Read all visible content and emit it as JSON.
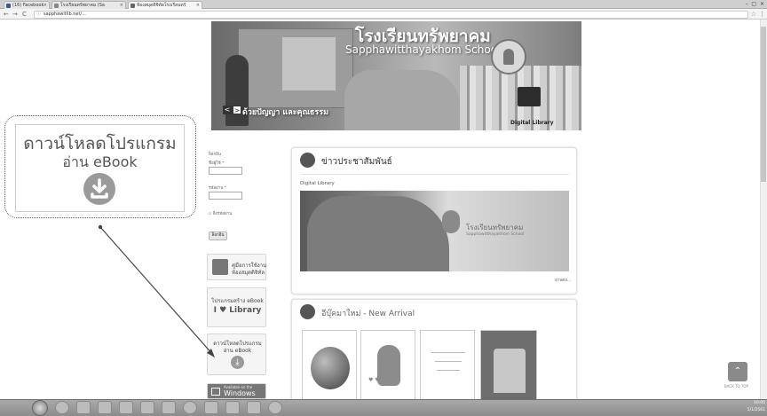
{
  "browser": {
    "tabs": [
      {
        "label": "(16) Facebook"
      },
      {
        "label": "โรงเรียนทรัพยาคม (Sa"
      },
      {
        "label": "ห้องสมุดดิจิทัลโรงเรียนทรั"
      }
    ],
    "window_controls": "– ▢ ×",
    "url": "sapphawitlib.net/..."
  },
  "banner": {
    "school_name_th": "โรงเรียนทรัพยาคม",
    "school_name_en": "Sapphawitthayakhom School",
    "slogan": "ด้วยปัญญา และคุณธรรม",
    "digital_library_label": "Digital Library",
    "prev_label": "<",
    "next_label": ">"
  },
  "login": {
    "heading": "ล็อกอิน",
    "username_label": "ชื่อผู้ใช้ *",
    "password_label": "รหัสผ่าน *",
    "remember_label": "จื่อรหัสผ่าน",
    "submit_label": "ล็อกอิน"
  },
  "sidebar": {
    "manual_line1": "คู่มือการใช้งาน",
    "manual_line2": "ห้องสมุดดิจิทัล",
    "create_ebook_label": "โปรแกรมสร้าง eBook",
    "ilibrary_label": "I ♥ Library",
    "download_line1": "ดาวน์โหลดโปรแกรม",
    "download_line2": "อ่าน eBook",
    "windows_line1": "Available on the",
    "windows_line2": "Windows"
  },
  "callout": {
    "line1": "ดาวน์โหลดโปรแกรม",
    "line2": "อ่าน eBook"
  },
  "news": {
    "title": "ข่าวประชาสัมพันธ์",
    "item_title": "Digital Library",
    "image_caption_th": "โรงเรียนทรัพยาคม",
    "image_caption_en": "Sapphawitthayakhom School",
    "read_more": "อ่านต่อ..."
  },
  "new_arrival": {
    "title": "อีบุ๊คมาใหม่ - New Arrival"
  },
  "back_to_top_label": "BACK TO TOP",
  "clock": {
    "time": "10:05",
    "date": "5/1/2561"
  }
}
